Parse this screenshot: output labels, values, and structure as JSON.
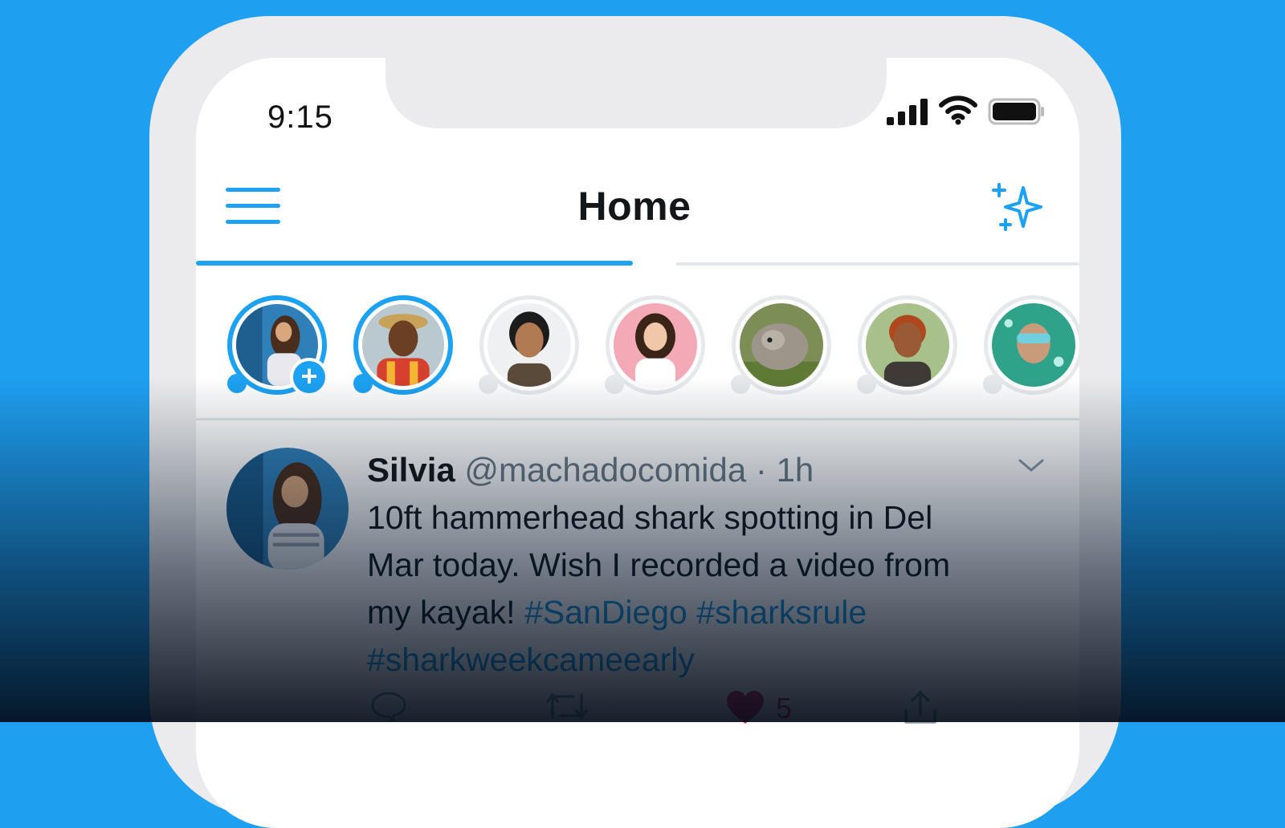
{
  "status_bar": {
    "time": "9:15",
    "icons": [
      "signal-icon",
      "wifi-icon",
      "battery-icon"
    ]
  },
  "header": {
    "title": "Home",
    "left_icon": "menu-icon",
    "right_icon": "sparkle-icon"
  },
  "tabs": {
    "active_index": 0,
    "count": 2
  },
  "stories": {
    "items": [
      {
        "name": "story-own",
        "state": "live",
        "has_add_badge": true,
        "add_label": "+"
      },
      {
        "name": "story-2",
        "state": "live"
      },
      {
        "name": "story-3",
        "state": "seen"
      },
      {
        "name": "story-4",
        "state": "seen"
      },
      {
        "name": "story-5",
        "state": "seen"
      },
      {
        "name": "story-6",
        "state": "seen"
      },
      {
        "name": "story-7",
        "state": "seen"
      }
    ]
  },
  "tweet": {
    "author_name": "Silvia",
    "author_handle": "@machadocomida",
    "separator": "·",
    "time": "1h",
    "text_line1": "10ft hammerhead shark spotting in Del",
    "text_line2": "Mar today. Wish I recorded a video from",
    "text_line3": "my kayak!",
    "hashtags": [
      "#SanDiego",
      "#sharksrule",
      "#sharkweekcameearly"
    ],
    "like_count": "5",
    "action_icons": [
      "reply-icon",
      "retweet-icon",
      "like-icon",
      "share-icon"
    ]
  },
  "colors": {
    "background": "#1f9ff0",
    "accent": "#1da1f2",
    "hashtag": "#1b95e0",
    "like": "#e0245e",
    "muted_text": "#6b7a87"
  }
}
